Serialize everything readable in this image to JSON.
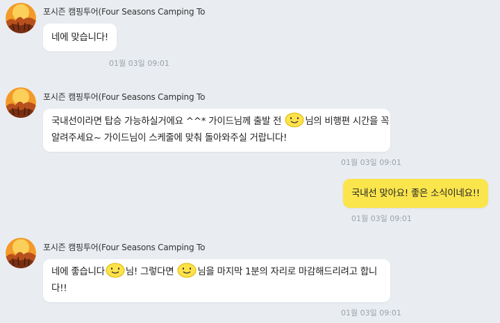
{
  "chat": {
    "messages": [
      {
        "sender": "포시즌 캠핑투어(Four Seasons Camping To",
        "lines": [
          "네에 맞습니다!"
        ],
        "time": "01월 03일 09:01"
      },
      {
        "sender": "포시즌 캠핑투어(Four Seasons Camping To",
        "line1_a": "국내선이라면 탑승 가능하실거에요 ^^* 가이드님께 출발 전",
        "line1_b": "님의 비행편 시간을 꼭",
        "line2": "알려주세요~ 가이드님이 스케줄에 맞춰 돌아와주실 거랍니다!",
        "time": "01월 03일 09:01"
      },
      {
        "mine": true,
        "text": "국내선 맞아요! 좋은 소식이네요!!",
        "time": "01월 03일 09:01"
      },
      {
        "sender": "포시즌 캠핑투어(Four Seasons Camping To",
        "line1_a": "네에 좋습니다",
        "line1_b": "님! 그렇다면",
        "line1_c": "님을 마지막 1분의 자리로 마감해드리려고 합니",
        "line2": "다!!",
        "time": "01월 03일 09:01"
      }
    ]
  },
  "icons": {
    "avatar": "camping-logo-avatar",
    "emoticon": "smiley-emoticon"
  },
  "colors": {
    "background": "#e9edf1",
    "incoming_bubble": "#ffffff",
    "outgoing_bubble": "#fae54d",
    "timestamp": "#9aa1a8"
  }
}
